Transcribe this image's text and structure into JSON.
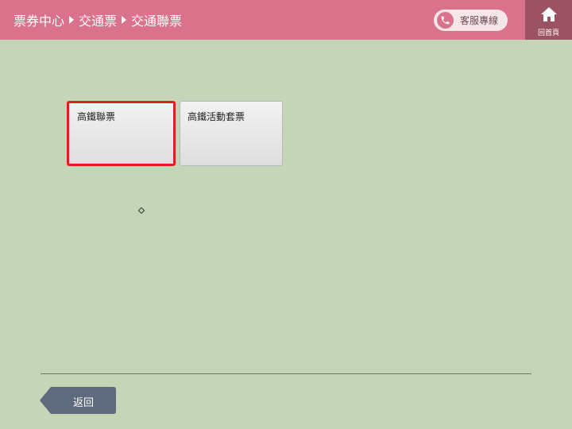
{
  "header": {
    "breadcrumb": [
      "票券中心",
      "交通票",
      "交通聯票"
    ],
    "service_label": "客服專線",
    "home_label": "回首頁"
  },
  "tiles": [
    {
      "label": "高鐵聯票",
      "selected": true
    },
    {
      "label": "高鐵活動套票",
      "selected": false
    }
  ],
  "footer": {
    "back_label": "返回"
  },
  "colors": {
    "header_bg": "#d9728a",
    "home_bg": "#9b5262",
    "page_bg": "#c5d5b8",
    "selected_border": "#e01e1e",
    "back_button": "#5d6b7c"
  },
  "icons": {
    "breadcrumb_separator": "triangle-right-icon",
    "service": "phone-icon",
    "home": "home-icon"
  }
}
